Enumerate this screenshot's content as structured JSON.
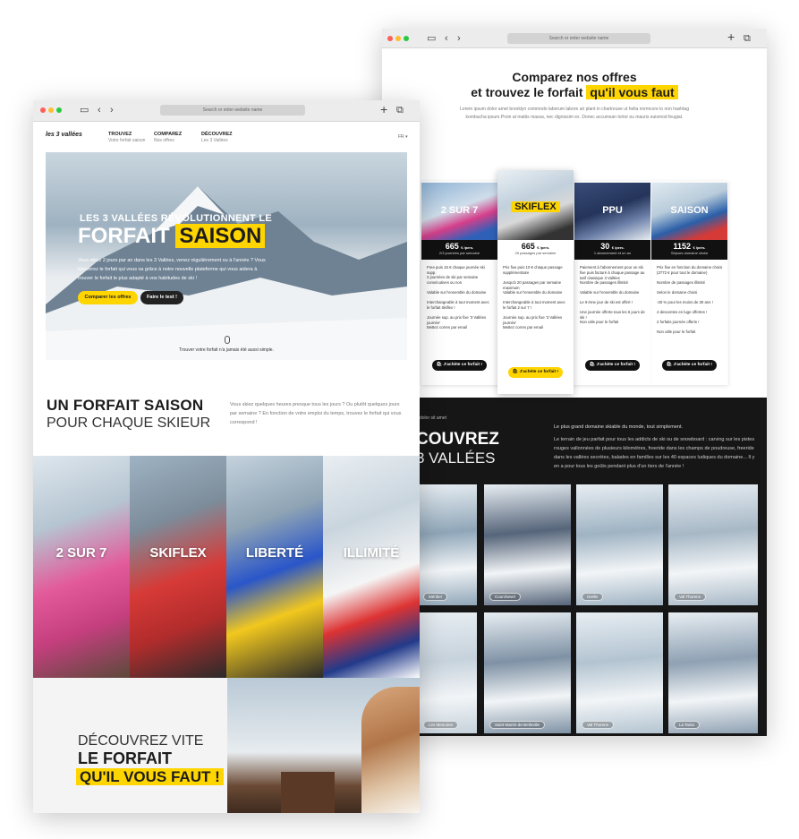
{
  "browser": {
    "url_placeholder": "Search or enter website name"
  },
  "colors": {
    "accent": "#ffd500",
    "dark": "#1c1c1c"
  },
  "front": {
    "nav": {
      "logo": "les 3 vallées",
      "items": [
        {
          "title": "TROUVEZ",
          "sub": "Votre forfait saison"
        },
        {
          "title": "COMPAREZ",
          "sub": "Nos offres"
        },
        {
          "title": "DÉCOUVREZ",
          "sub": "Les 3 Vallées"
        }
      ],
      "lang": "FR"
    },
    "hero": {
      "line1": "LES 3 VALLÉES RÉVOLUTIONNENT LE",
      "line2a": "FORFAIT",
      "line2b": "SAISON",
      "text": "Vous skiez 2 jours par an dans les 3 Vallées, venez régulièrement ou à l'année ? Vous trouverez le forfait qui vous va grâce à notre nouvelle plateforme qui vous aidera à trouver le forfait le plus adapté à vos habitudes de ski !",
      "btn_primary": "Comparer les offres",
      "btn_secondary": "Faire le test !",
      "scroll_text": "Trouver votre forfait n'a jamais été aussi simple."
    },
    "section2": {
      "title_bold": "UN FORFAIT SAISON",
      "title_light": "POUR CHAQUE SKIEUR",
      "text": "Vous skiez quelques heures presque tous les jours ? Ou plutôt quelques jours par semaine ? En fonction de votre emploi du temps, trouvez le forfait qui vous correspond !"
    },
    "passes": [
      "2 SUR 7",
      "SKIFLEX",
      "LIBERTÉ",
      "ILLIMITÉ"
    ],
    "section3": {
      "line1": "DÉCOUVREZ VITE",
      "line2": "LE FORFAIT",
      "line3": "QU'IL VOUS FAUT !"
    }
  },
  "back": {
    "title_line1": "Comparez nos offres",
    "title_line2a": "et trouvez le forfait",
    "title_line2b": "qu'il vous faut",
    "intro": "Lorem ipsum dolor amet brooklyn commodo laborum labore air plant in chartreuse ut hella normcore lo non hashtag kombucha ipsum.Proin at mattis massa, nec dignissim ex. Donec accumsan tortor eu mauris euismod feugiat.",
    "cards": [
      {
        "name": "2 SUR 7",
        "price": "665",
        "unit": "€ /pers.",
        "sub": "2/3 journées par semaine",
        "features": [
          "Free puis 15 € chaque journée ski supp.",
          "2 journées de ski par semaine consécutives ou non",
          "Valable sur l'ensemble du domaine",
          "Interchangeable à tout moment avec le forfait Skiflex !",
          "Journée sup. au prix fixe '3 Vallées journée'",
          "Mettez corres par email"
        ],
        "cta": "J'achète ce forfait !"
      },
      {
        "name": "SKIFLEX",
        "price": "665",
        "unit": "€ /pers.",
        "sub": "20 passages par semaine",
        "features": [
          "Prix fixe puis 10 € chaque passage supplémentaire",
          "Jusqu'à 20 passages par semaine maximum",
          "Valable sur l'ensemble du domaine",
          "Interchangeable à tout moment avec le forfait 2 sur 7 !",
          "Journée sup. au prix fixe '3 Vallées journée'",
          "Mettez corres par email"
        ],
        "cta": "J'achète ce forfait !"
      },
      {
        "name": "PPU",
        "price": "30",
        "unit": "€ /pers.",
        "sub": "1 abonnement et un an",
        "features": [
          "Paiement à l'abonnement pour un ski fixe puis facturé à chaque passage au tarif classique 3 Vallées",
          "Nombre de passages illimité",
          "Valable sur l'ensemble du domaine",
          "Le 9 ème jour de ski est offert !",
          "Une journée offerte tous les 6 jours de ski !",
          "Non utile pour le forfait"
        ],
        "cta": "J'achète ce forfait !"
      },
      {
        "name": "SAISON",
        "price": "1152",
        "unit": "€ /pers.",
        "sub": "Séjours domaine choisi",
        "features": [
          "Prix fixe en fonction du domaine choisi (3772 € pour tout le domaine)",
          "Nombre de passages illimité",
          "Selon le domaine choisi",
          "-30 % pour les moins de 30 ans !",
          "4 descentes en luge offertes !",
          "2 forfaits journée offerts !",
          "Non utile pour le forfait"
        ],
        "cta": "J'achète ce forfait !"
      }
    ],
    "dark": {
      "kicker": "dolor sit amet",
      "title1": "COUVREZ",
      "title2": "3 VALLÉES",
      "lead": "Le plus grand domaine skiable du monde, tout simplement.",
      "text": "Le terrain de jeu parfait pour tous les addicts de ski ou de snowboard : carving sur les pistes rouges vallonnées de plusieurs kilomètres, freeride dans les champs de poudreuse, freeride dans les vallées secrètes, balades en familles sur les 40 espaces ludiques du domaine... Il y en a pour tous les goûts pendant plus d'un tiers de l'année !"
    },
    "gallery": [
      "Méribel",
      "Courchevel",
      "Orelle",
      "Val Thorens",
      "Les Menuires",
      "Saint-Martin-de-Belleville",
      "Val Thorens",
      "La Tania"
    ]
  }
}
